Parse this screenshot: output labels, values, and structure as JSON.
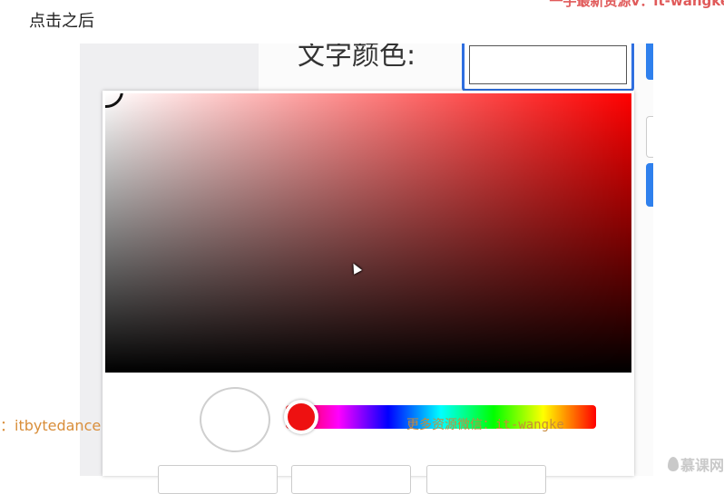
{
  "caption": "点击之后",
  "watermarks": {
    "top_right": "一手最新资源v：it-wangke",
    "left": "：itbytedance",
    "middle": "更多资源微信：it-wangke",
    "brand": "慕课网"
  },
  "app": {
    "field_label": "文字颜色:",
    "text_color_value": "#ffffff"
  },
  "picker": {
    "hue": 0,
    "hue_color": "#ff0000",
    "saturation": 0,
    "brightness": 1,
    "preview_color": "#ffffff"
  },
  "colors": {
    "accent_blue": "#2f6fe0"
  }
}
